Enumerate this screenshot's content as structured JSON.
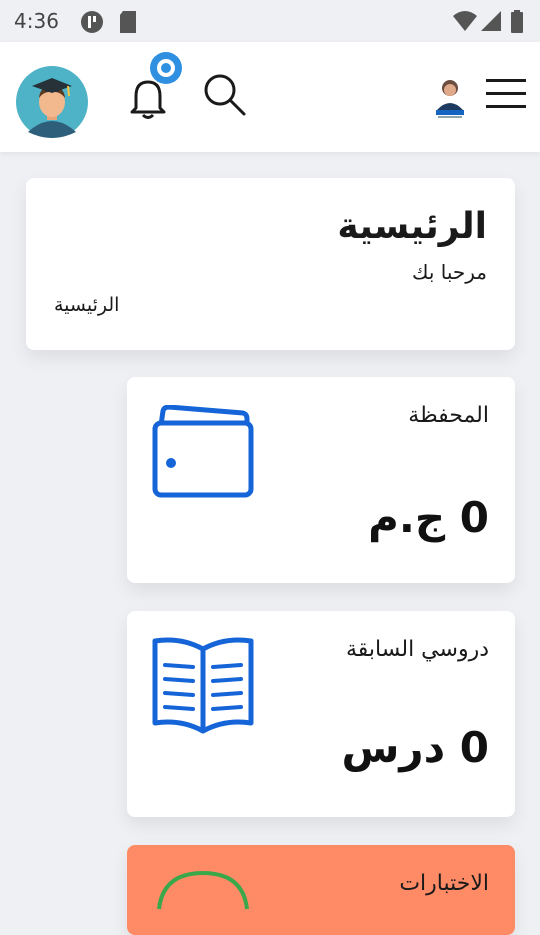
{
  "status_bar": {
    "time": "4:36"
  },
  "app_bar": {
    "notification_badge_color": "#2f8fe0"
  },
  "home": {
    "title": "الرئيسية",
    "subtitle": "مرحبا بك",
    "breadcrumb": "الرئيسية"
  },
  "wallet": {
    "title": "المحفظة",
    "value": "0 ج.م",
    "icon": "wallet-icon"
  },
  "lessons": {
    "title": "دروسي السابقة",
    "value": "0 درس",
    "icon": "open-book-icon"
  },
  "exams": {
    "title": "الاختبارات",
    "color": "#ff8a66"
  },
  "colors": {
    "accent": "#1565d8",
    "background": "#eef0f4"
  }
}
